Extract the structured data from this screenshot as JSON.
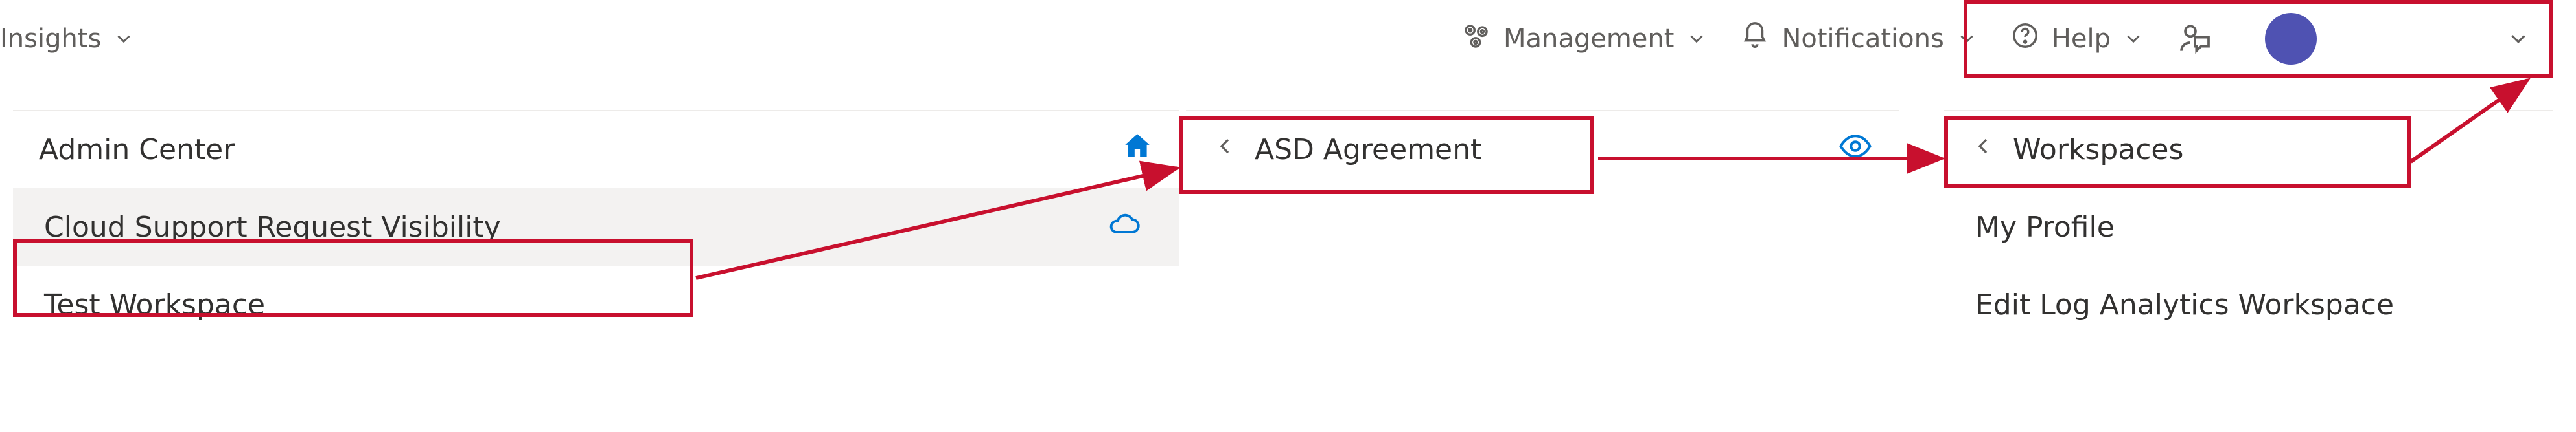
{
  "topnav": {
    "insights_label": "Insights",
    "management_label": "Management",
    "notifications_label": "Notifications",
    "help_label": "Help"
  },
  "profile": {
    "display_name": ""
  },
  "panels": {
    "left": {
      "title": "Admin Center",
      "items": [
        {
          "label": "Cloud Support Request Visibility",
          "selected": true,
          "icon": "cloud"
        },
        {
          "label": "Test Workspace",
          "selected": false,
          "icon": ""
        }
      ]
    },
    "mid": {
      "title": "ASD Agreement"
    },
    "right": {
      "title": "Workspaces",
      "items": [
        {
          "label": "My Profile"
        },
        {
          "label": "Edit Log Analytics Workspace"
        }
      ]
    }
  },
  "colors": {
    "accent_blue": "#0078d4",
    "avatar": "#4f52b2",
    "annotation": "#c8102e"
  }
}
